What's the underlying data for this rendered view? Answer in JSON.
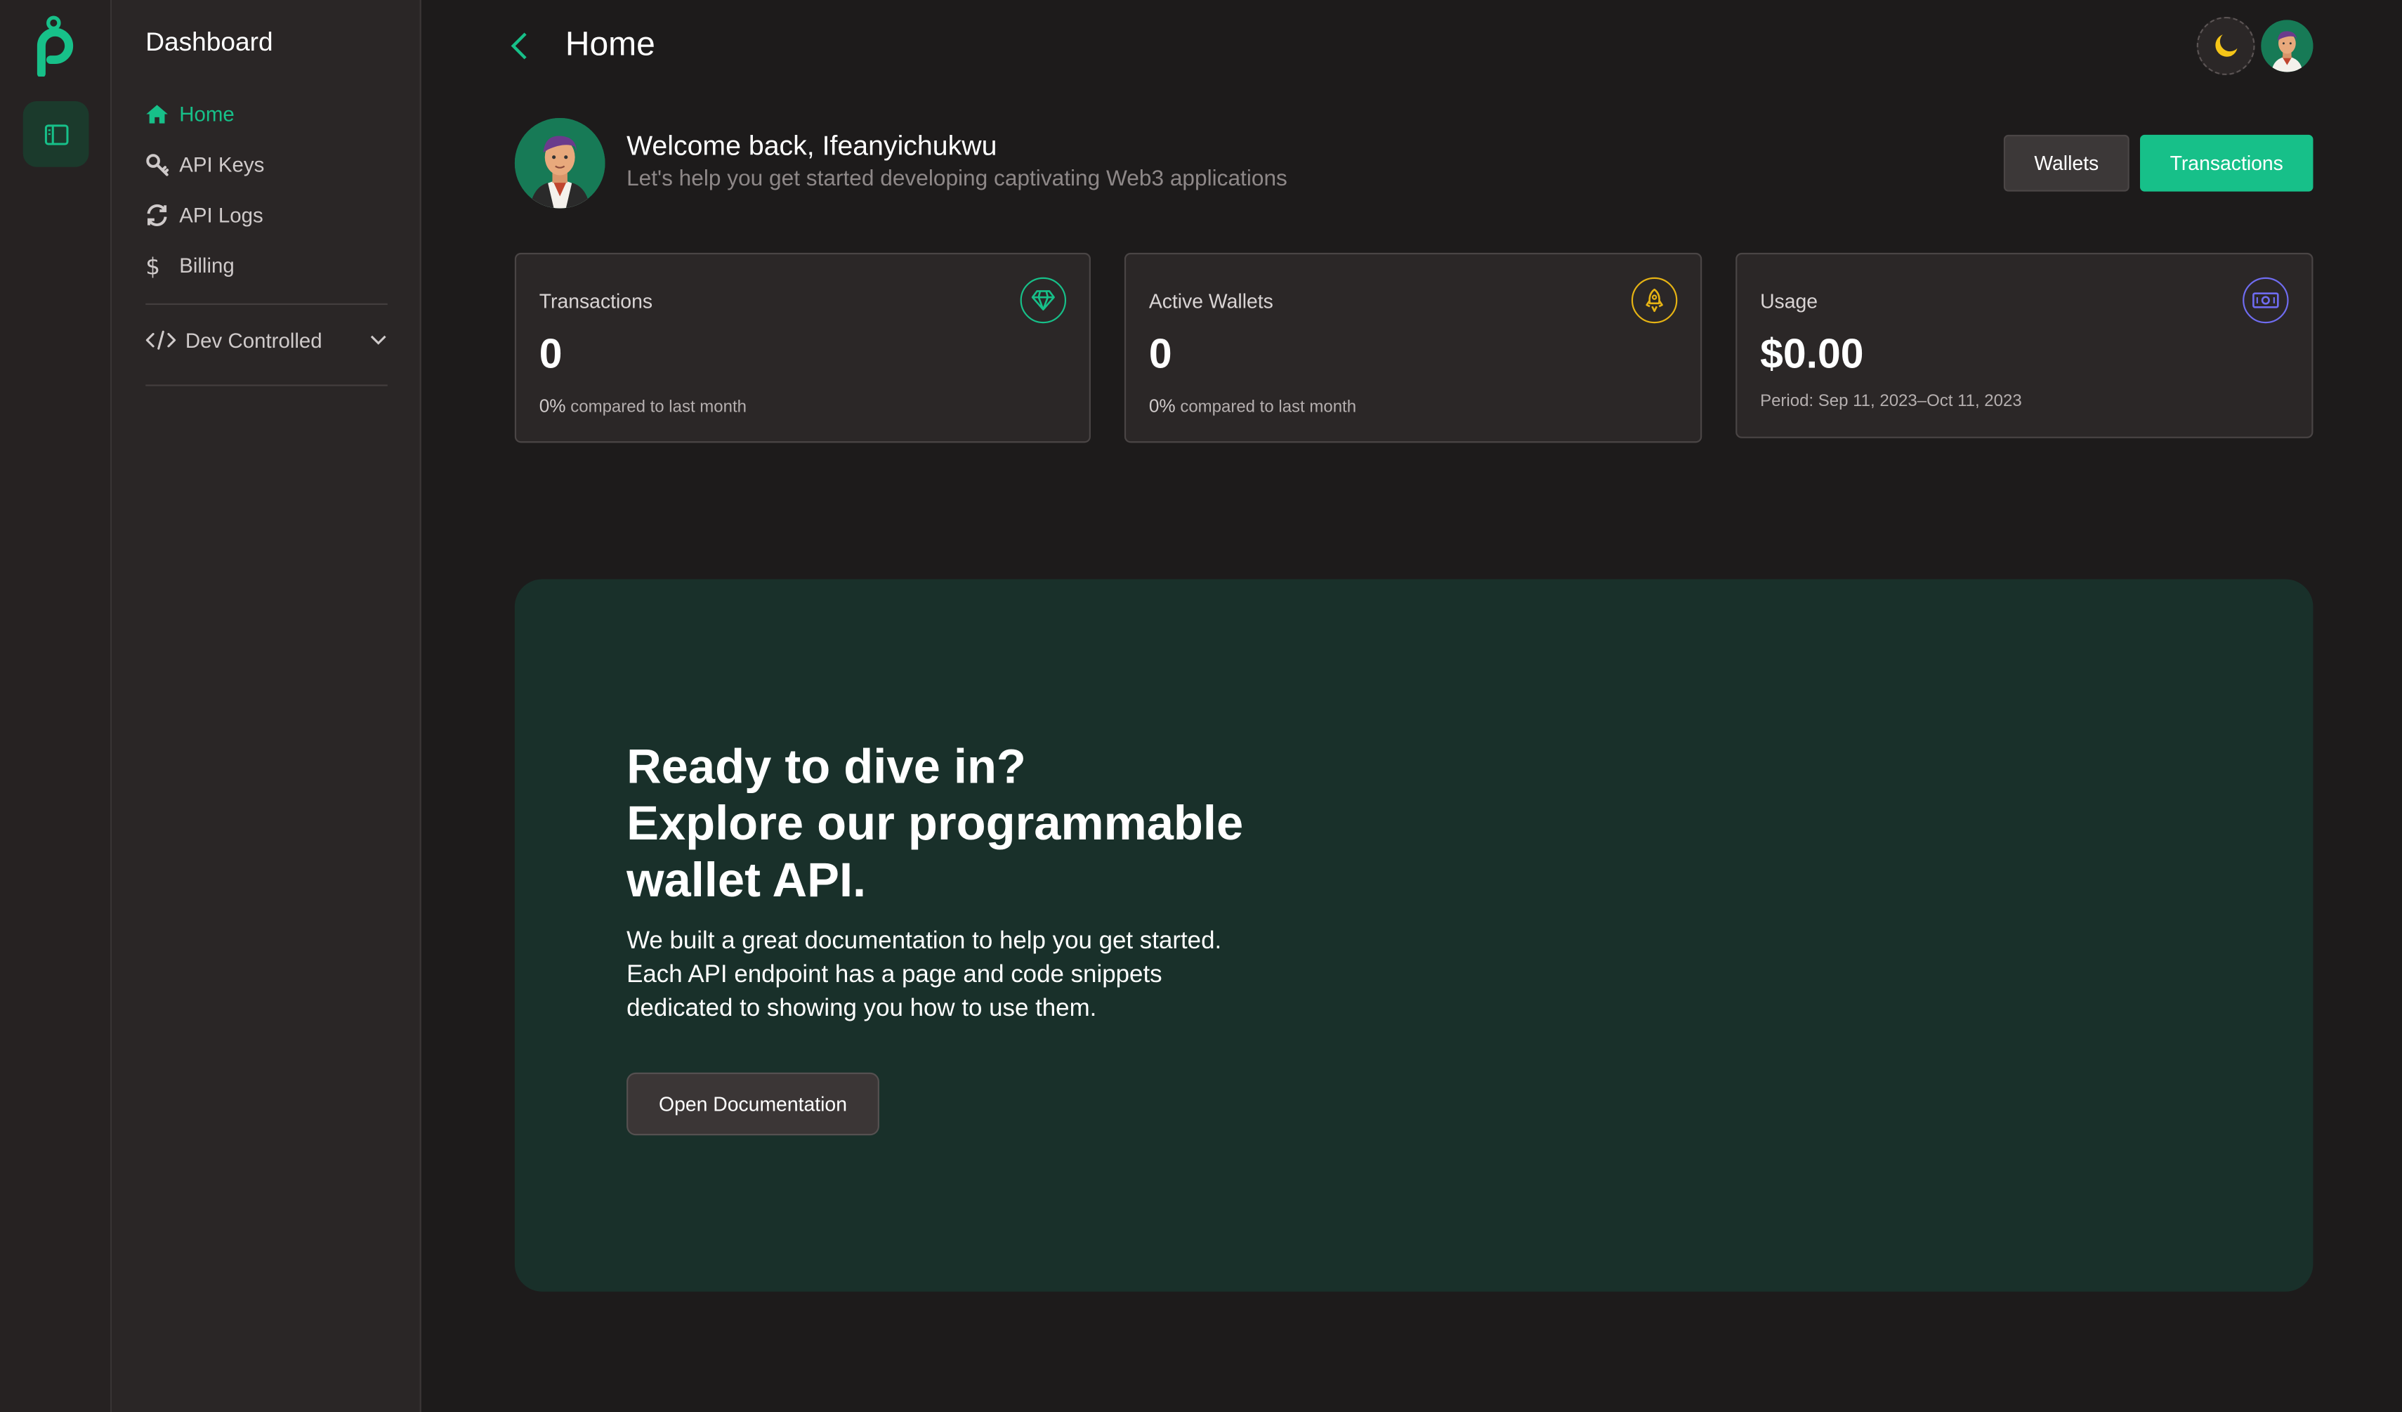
{
  "colors": {
    "accent": "#17c089",
    "background": "#1d1b1b",
    "sidebar": "#2a2626",
    "banner": "#19302a",
    "transactions_icon": "#17c089",
    "wallets_icon": "#e6b314",
    "usage_icon": "#6f6cf0"
  },
  "sidebar": {
    "title": "Dashboard",
    "items": [
      {
        "label": "Home",
        "icon": "home-icon",
        "active": true
      },
      {
        "label": "API Keys",
        "icon": "key-icon",
        "active": false
      },
      {
        "label": "API Logs",
        "icon": "refresh-icon",
        "active": false
      },
      {
        "label": "Billing",
        "icon": "dollar-icon",
        "active": false
      }
    ],
    "group": {
      "label": "Dev Controlled",
      "icon": "code-icon"
    }
  },
  "header": {
    "title": "Home"
  },
  "welcome": {
    "title": "Welcome back, Ifeanyichukwu",
    "subtitle": "Let's help you get started developing captivating Web3 applications"
  },
  "actions": {
    "wallets_label": "Wallets",
    "transactions_label": "Transactions"
  },
  "cards": [
    {
      "label": "Transactions",
      "value": "0",
      "change": "0%",
      "foot": "compared to last month",
      "icon": "diamond-icon"
    },
    {
      "label": "Active Wallets",
      "value": "0",
      "change": "0%",
      "foot": "compared to last month",
      "icon": "rocket-icon"
    },
    {
      "label": "Usage",
      "value": "$0.00",
      "foot": "Period: Sep 11, 2023–Oct 11, 2023",
      "icon": "cash-icon"
    }
  ],
  "banner": {
    "heading": [
      "Ready to dive in?",
      "Explore our programmable",
      "wallet API."
    ],
    "body": [
      "We built a great documentation to help you get started.",
      "Each API endpoint has a page and code snippets",
      "dedicated to showing you how to use them."
    ],
    "button_label": "Open Documentation"
  }
}
